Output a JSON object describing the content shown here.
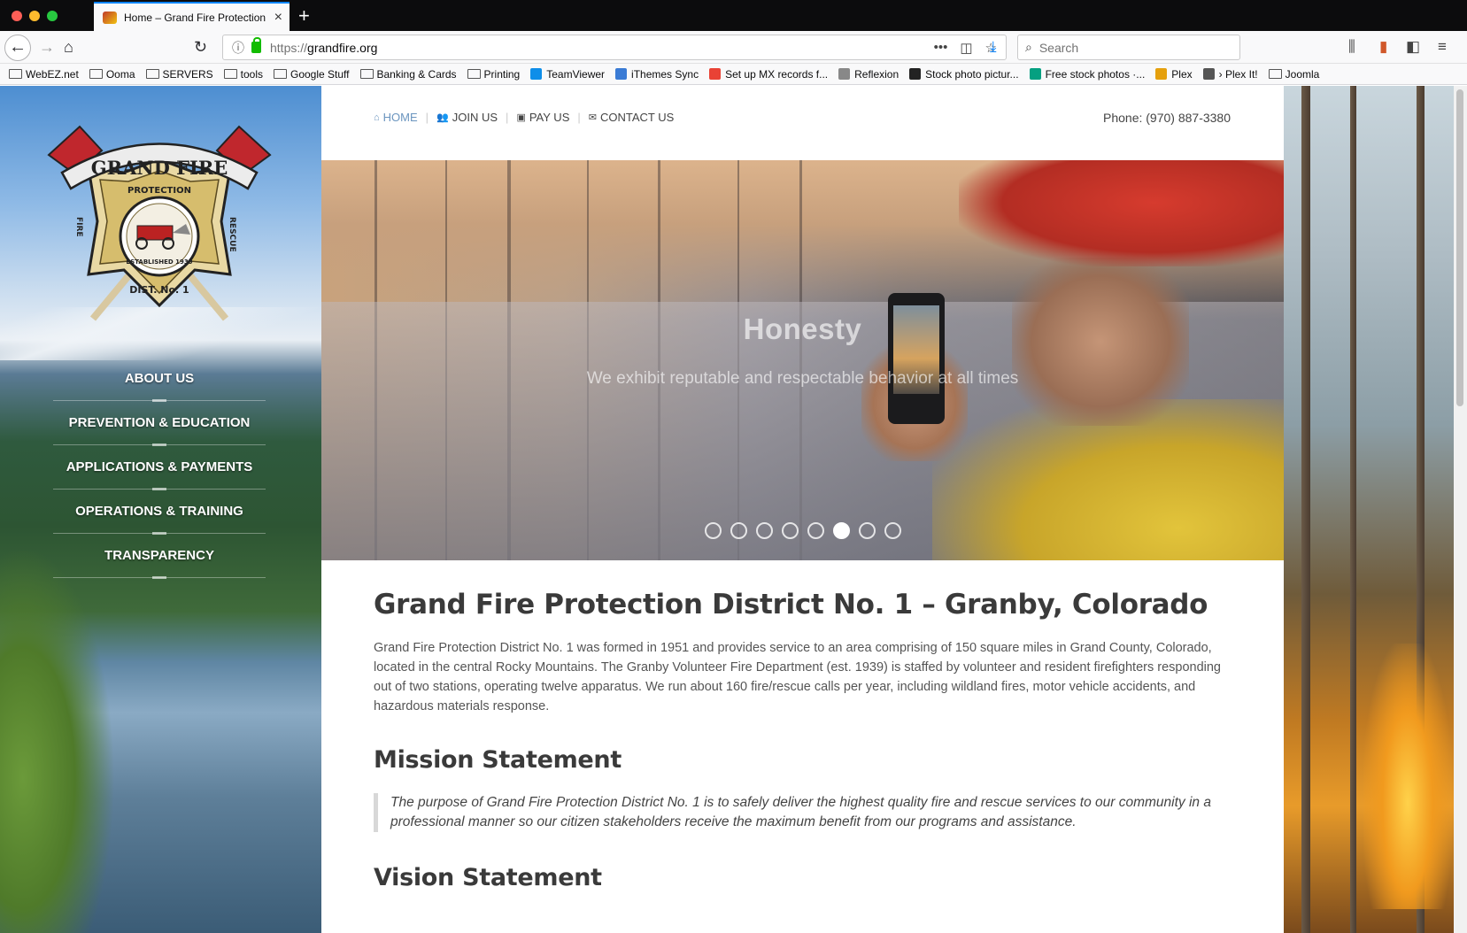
{
  "browser": {
    "tab_title": "Home – Grand Fire Protection D",
    "url_scheme": "https://",
    "url_host": "grandfire.org",
    "search_placeholder": "Search"
  },
  "bookmarks": [
    {
      "label": "WebEZ.net",
      "icon": "folder-icon"
    },
    {
      "label": "Ooma",
      "icon": "folder-icon"
    },
    {
      "label": "SERVERS",
      "icon": "folder-icon"
    },
    {
      "label": "tools",
      "icon": "folder-icon"
    },
    {
      "label": "Google Stuff",
      "icon": "folder-icon"
    },
    {
      "label": "Banking & Cards",
      "icon": "folder-icon"
    },
    {
      "label": "Printing",
      "icon": "folder-icon"
    },
    {
      "label": "TeamViewer",
      "icon": "teamviewer-icon"
    },
    {
      "label": "iThemes Sync",
      "icon": "ithemes-icon"
    },
    {
      "label": "Set up MX records f...",
      "icon": "google-icon"
    },
    {
      "label": "Reflexion",
      "icon": "reflexion-icon"
    },
    {
      "label": "Stock photo pictur...",
      "icon": "camera-icon"
    },
    {
      "label": "Free stock photos ·...",
      "icon": "pexels-icon"
    },
    {
      "label": "Plex",
      "icon": "plex-icon"
    },
    {
      "label": "› Plex It!",
      "icon": "globe-icon"
    },
    {
      "label": "Joomla",
      "icon": "folder-icon"
    }
  ],
  "logo": {
    "arc_text": "GRAND FIRE",
    "top_text": "PROTECTION",
    "left_text": "FIRE",
    "right_text": "RESCUE",
    "est_text": "ESTABLISHED 1939",
    "bottom_text": "DIST. No. 1"
  },
  "left_nav": [
    "ABOUT US",
    "PREVENTION & EDUCATION",
    "APPLICATIONS & PAYMENTS",
    "OPERATIONS & TRAINING",
    "TRANSPARENCY"
  ],
  "top_nav": {
    "home": "HOME",
    "join": "JOIN US",
    "pay": "PAY US",
    "contact": "CONTACT US"
  },
  "phone": "Phone: (970) 887-3380",
  "slider": {
    "title": "Honesty",
    "subtitle": "We exhibit reputable and respectable behavior at all times",
    "total_slides": 8,
    "active_slide": 6
  },
  "content": {
    "heading": "Grand Fire Protection District No. 1 – Granby, Colorado",
    "intro": "Grand Fire Protection District No. 1 was formed in 1951 and provides service to an area comprising of 150 square miles in Grand County, Colorado, located in the central Rocky Mountains. The Granby Volunteer Fire Department (est. 1939) is staffed by volunteer and resident firefighters responding out of two stations, operating twelve apparatus. We run about 160 fire/rescue calls per year, including wildland fires, motor vehicle accidents, and hazardous materials response.",
    "mission_heading": "Mission Statement",
    "mission_text": "The purpose of Grand Fire Protection District No. 1 is to safely deliver the highest quality fire and rescue services to our community in a professional manner so our citizen stakeholders receive the maximum benefit from our programs and assistance.",
    "vision_heading": "Vision Statement"
  }
}
